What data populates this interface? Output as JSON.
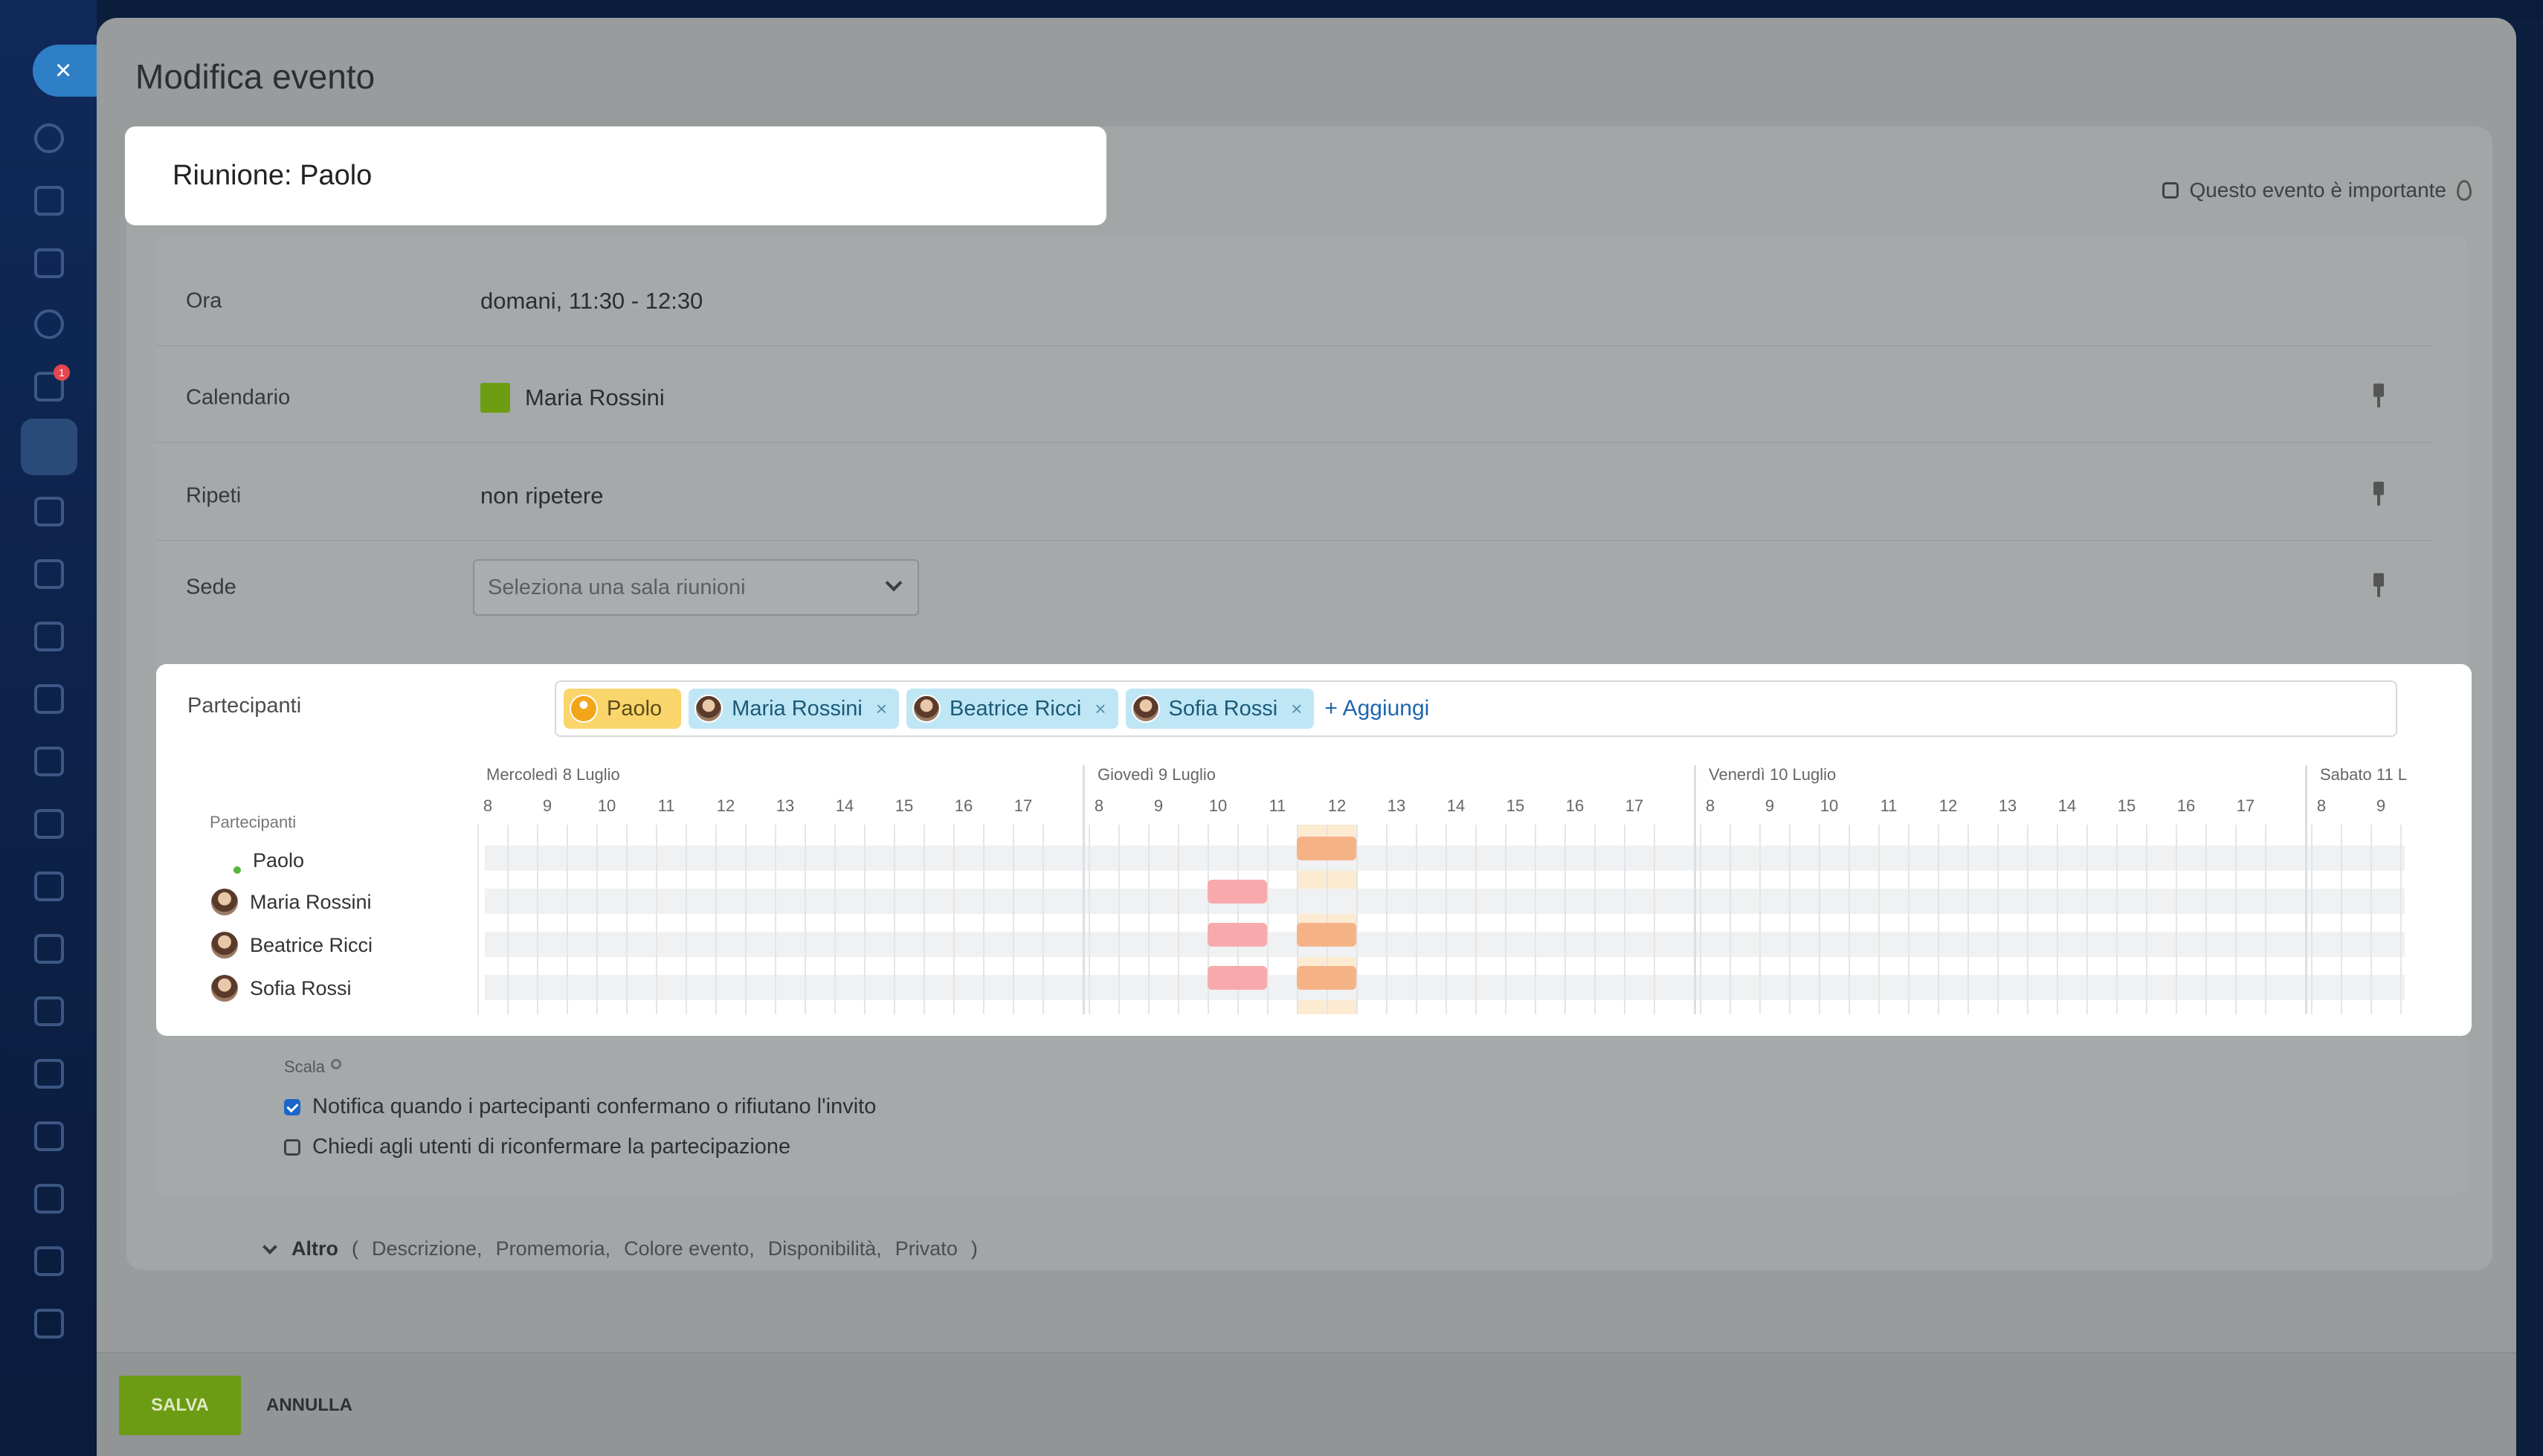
{
  "app": {
    "close_label": "×"
  },
  "modal": {
    "title": "Modifica evento",
    "event_title": "Riunione: Paolo",
    "important_label": "Questo evento è importante"
  },
  "fields": {
    "time": {
      "label": "Ora",
      "value": "domani, 11:30 - 12:30"
    },
    "calendar": {
      "label": "Calendario",
      "value": "Maria Rossini",
      "color": "#6d9d12"
    },
    "repeat": {
      "label": "Ripeti",
      "value": "non ripetere"
    },
    "location": {
      "label": "Sede",
      "placeholder": "Seleziona una sala riunioni"
    }
  },
  "participants": {
    "label": "Partecipanti",
    "tokens": [
      {
        "name": "Paolo",
        "role": "owner"
      },
      {
        "name": "Maria Rossini",
        "removable": true
      },
      {
        "name": "Beatrice Ricci",
        "removable": true
      },
      {
        "name": "Sofia Rossi",
        "removable": true
      }
    ],
    "add_label": "+ Aggiungi",
    "remove_label": "×"
  },
  "schedule": {
    "names_header": "Partecipanti",
    "people": [
      "Paolo",
      "Maria Rossini",
      "Beatrice Ricci",
      "Sofia Rossi"
    ],
    "days": [
      {
        "label": "Mercoledì 8 Luglio",
        "hours": [
          "8",
          "9",
          "10",
          "11",
          "12",
          "13",
          "14",
          "15",
          "16",
          "17"
        ]
      },
      {
        "label": "Giovedì 9 Luglio",
        "hours": [
          "8",
          "9",
          "10",
          "11",
          "12",
          "13",
          "14",
          "15",
          "16",
          "17"
        ]
      },
      {
        "label": "Venerdì 10 Luglio",
        "hours": [
          "8",
          "9",
          "10",
          "11",
          "12",
          "13",
          "14",
          "15",
          "16",
          "17"
        ]
      },
      {
        "label": "Sabato 11 L",
        "hours": [
          "8",
          "9"
        ]
      }
    ],
    "busy": [
      {
        "person": "Paolo",
        "day": "Giovedì 9 Luglio",
        "from": 11.5,
        "to": 12.5,
        "kind": "event"
      },
      {
        "person": "Maria Rossini",
        "day": "Giovedì 9 Luglio",
        "from": 10,
        "to": 11,
        "kind": "busy"
      },
      {
        "person": "Beatrice Ricci",
        "day": "Giovedì 9 Luglio",
        "from": 10,
        "to": 11,
        "kind": "busy"
      },
      {
        "person": "Beatrice Ricci",
        "day": "Giovedì 9 Luglio",
        "from": 11.5,
        "to": 12.5,
        "kind": "event"
      },
      {
        "person": "Sofia Rossi",
        "day": "Giovedì 9 Luglio",
        "from": 10,
        "to": 11,
        "kind": "busy"
      },
      {
        "person": "Sofia Rossi",
        "day": "Giovedì 9 Luglio",
        "from": 11.5,
        "to": 12.5,
        "kind": "event"
      }
    ],
    "scale_label": "Scala"
  },
  "options": {
    "notify": {
      "label": "Notifica quando i partecipanti confermano o rifiutano l'invito",
      "checked": true
    },
    "reconfirm": {
      "label": "Chiedi agli utenti di riconfermare la partecipazione",
      "checked": false
    }
  },
  "more": {
    "label": "Altro",
    "open_paren": "(",
    "close_paren": ")",
    "items": [
      "Descrizione,",
      "Promemoria,",
      "Colore evento,",
      "Disponibilità,",
      "Privato"
    ]
  },
  "footer": {
    "save_label": "SALVA",
    "cancel_label": "ANNULLA"
  },
  "colors": {
    "save": "#6b9c14",
    "token_owner": "#f9d56b",
    "token_guest": "#bfe6f5",
    "busy": "#f7a9ac",
    "event": "#f6b287"
  }
}
